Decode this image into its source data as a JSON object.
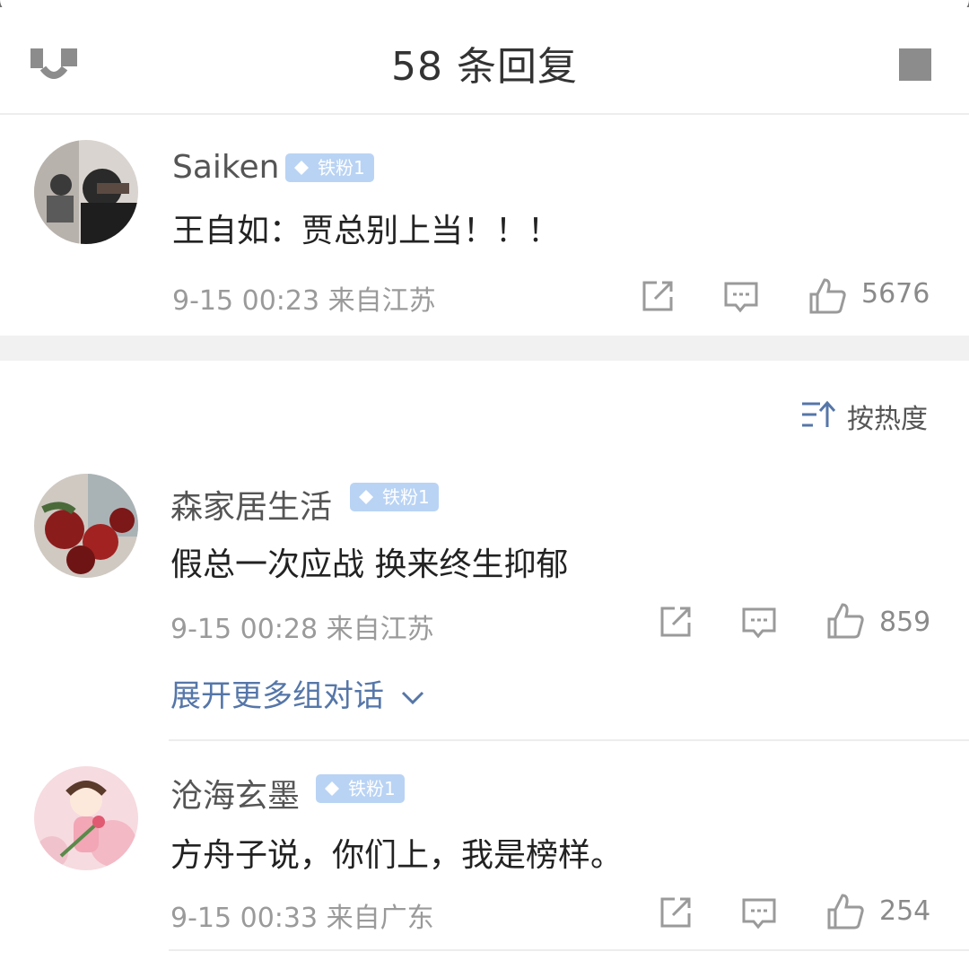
{
  "header": {
    "title": "58 条回复"
  },
  "main_comment": {
    "username": "Saiken",
    "badge": "铁粉1",
    "text": "王自如：贾总别上当！！！",
    "time": "9-15 00:23",
    "location": "来自江苏",
    "likes": "5676"
  },
  "sort": {
    "label": "按热度"
  },
  "replies": [
    {
      "username": "森家居生活",
      "badge": "铁粉1",
      "text": "假总一次应战 换来终生抑郁",
      "time": "9-15 00:28",
      "location": "来自江苏",
      "likes": "859",
      "expand_label": "展开更多组对话"
    },
    {
      "username": "沧海玄墨",
      "badge": "铁粉1",
      "text": "方舟子说，你们上，我是榜样。",
      "time": "9-15 00:33",
      "location": "来自广东",
      "likes": "254"
    }
  ],
  "colors": {
    "badge_bg": "#b9d3f4",
    "link": "#5576a8",
    "divider": "#ededed"
  },
  "icons": [
    "back-icon",
    "menu-icon",
    "share-icon",
    "comment-icon",
    "like-icon",
    "sort-icon",
    "chevron-down-icon",
    "diamond-icon"
  ]
}
